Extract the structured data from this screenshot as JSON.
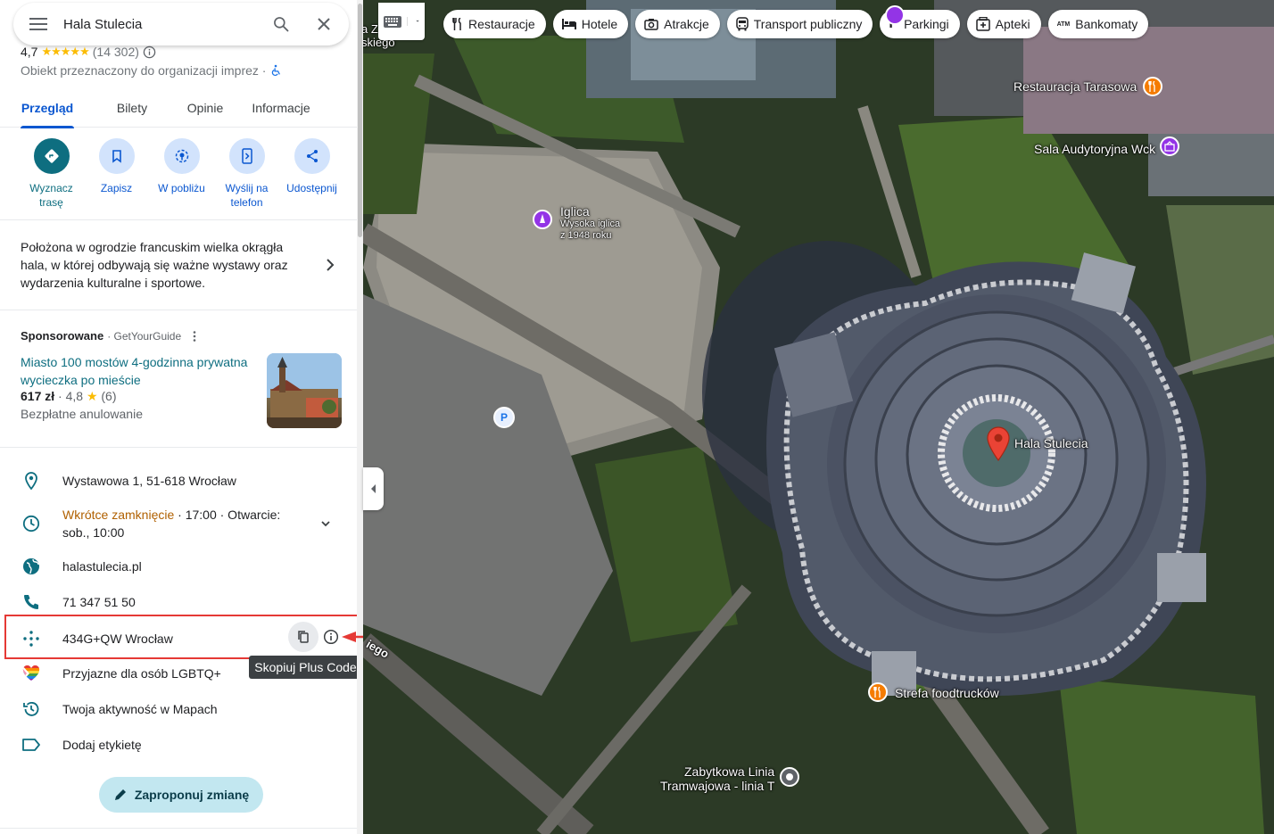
{
  "search": {
    "query": "Hala Stulecia"
  },
  "place": {
    "rating": "4,7",
    "stars": "★★★★★",
    "reviews_count": "(14 302)",
    "category": "Obiekt przeznaczony do organizacji imprez ·"
  },
  "tabs": [
    {
      "label": "Przegląd",
      "active": true
    },
    {
      "label": "Bilety"
    },
    {
      "label": "Opinie"
    },
    {
      "label": "Informacje"
    }
  ],
  "actions": [
    {
      "label": "Wyznacz trasę",
      "icon": "directions-icon"
    },
    {
      "label": "Zapisz",
      "icon": "bookmark-icon"
    },
    {
      "label": "W pobliżu",
      "icon": "nearby-icon"
    },
    {
      "label": "Wyślij na telefon",
      "icon": "send-to-phone-icon"
    },
    {
      "label": "Udostępnij",
      "icon": "share-icon"
    }
  ],
  "description": "Położona w ogrodzie francuskim wielka okrągła hala, w której odbywają się ważne wystawy oraz wydarzenia kulturalne i sportowe.",
  "sponsored": {
    "label": "Sponsorowane",
    "source": "· GetYourGuide",
    "title": "Miasto 100 mostów 4-godzinna prywatna wycieczka po mieście",
    "price": "617 zł",
    "rating": "· 4,8",
    "rating_star": "★",
    "rating_count": "(6)",
    "cancellation": "Bezpłatne anulowanie"
  },
  "info": {
    "address": "Wystawowa 1, 51-618 Wrocław",
    "hours_status": "Wkrótce zamknięcie",
    "hours_rest": " · 17:00 · Otwarcie:",
    "hours_next": "sob., 10:00",
    "website": "halastulecia.pl",
    "phone": "71 347 51 50",
    "plus_code": "434G+QW Wrocław",
    "lgbtq": "Przyjazne dla osób LGBTQ+",
    "activity": "Twoja aktywność w Mapach",
    "label": "Dodaj etykietę"
  },
  "tooltip": "Skopiuj Plus Code",
  "suggest_edit": "Zaproponuj zmianę",
  "chips": [
    {
      "label": "Restauracje",
      "icon": "fork-knife-icon"
    },
    {
      "label": "Hotele",
      "icon": "bed-icon"
    },
    {
      "label": "Atrakcje",
      "icon": "camera-icon"
    },
    {
      "label": "Transport publiczny",
      "icon": "bus-icon"
    },
    {
      "label": "Parkingi",
      "icon": "parking-icon"
    },
    {
      "label": "Apteki",
      "icon": "pharmacy-icon"
    },
    {
      "label": "Bankomaty",
      "icon": "atm-icon"
    }
  ],
  "map_labels": {
    "tarasowa": "Restauracja Tarasowa",
    "sala": "Sala Audytoryjna Wck",
    "iglica": "Iglica",
    "iglica_sub1": "Wysoka iglica",
    "iglica_sub2": "z 1948 roku",
    "hala": "Hala Stulecia",
    "foodtrucks": "Strefa foodtrucków",
    "tram1": "Zabytkowa Linia",
    "tram2": "Tramwajowa - linia T",
    "road_partial_1": "a Z",
    "road_partial_2": "skiego",
    "road_partial_3": "iego"
  },
  "colors": {
    "accent": "#0b57d0",
    "teal": "#0e6e80",
    "highlight_red": "#e53935",
    "orange_status": "#b06000",
    "pin_red": "#ea4335"
  }
}
